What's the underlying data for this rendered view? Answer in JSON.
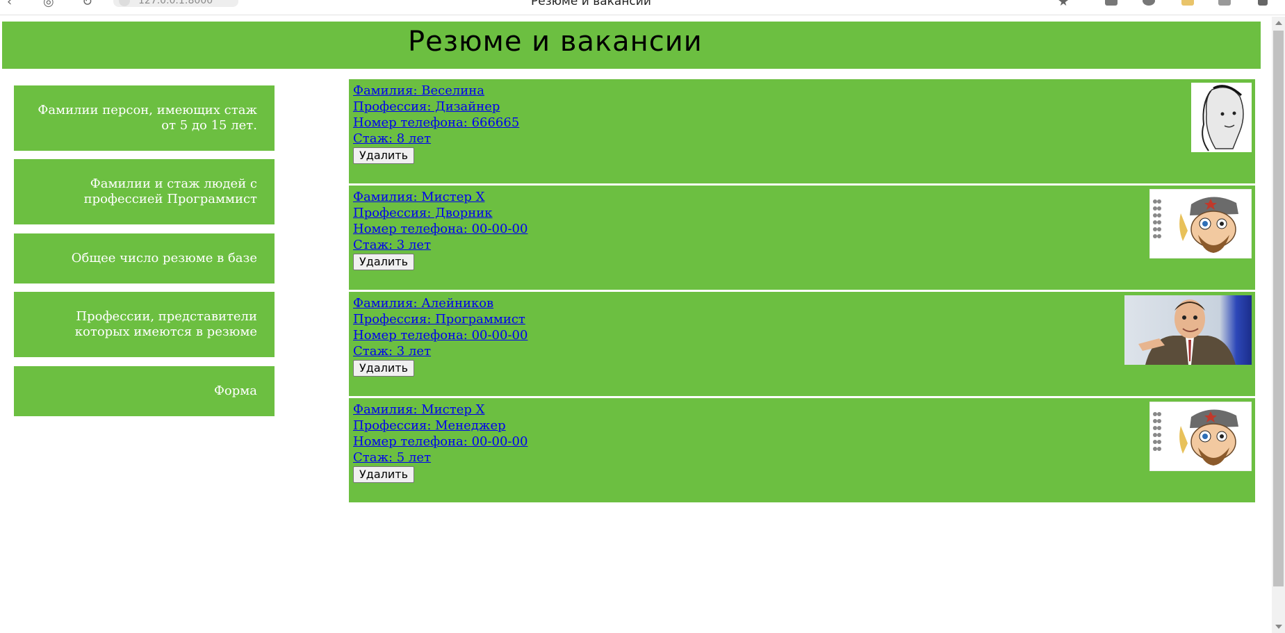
{
  "browser": {
    "url": "127.0.0.1:8000",
    "tab_title": "Резюме и вакансии"
  },
  "header": {
    "title": "Резюме и вакансии"
  },
  "sidebar": {
    "items": [
      {
        "label": "Фамилии персон, имеющих стаж от 5 до 15 лет."
      },
      {
        "label": "Фамилии и стаж людей с профессией Программист"
      },
      {
        "label": "Общее число резюме в базе"
      },
      {
        "label": "Профессии, представители которых имеются в резюме"
      },
      {
        "label": "Форма"
      }
    ]
  },
  "resumes": [
    {
      "surname": "Фамилия: Веселина",
      "profession": "Профессия: Дизайнер",
      "phone": "Номер телефона: 666665",
      "experience": "Стаж: 8 лет",
      "delete_label": "Удалить",
      "photo": "sketch-portrait"
    },
    {
      "surname": "Фамилия: Мистер Х",
      "profession": "Профессия: Дворник",
      "phone": "Номер телефона: 00-00-00",
      "experience": "Стаж: 3 лет",
      "delete_label": "Удалить",
      "photo": "cartoon-face-screenshot"
    },
    {
      "surname": "Фамилия: Алейников",
      "profession": "Профессия: Программист",
      "phone": "Номер телефона: 00-00-00",
      "experience": "Стаж: 3 лет",
      "delete_label": "Удалить",
      "photo": "man-pointing-photo"
    },
    {
      "surname": "Фамилия: Мистер Х",
      "profession": "Профессия: Менеджер",
      "phone": "Номер телефона: 00-00-00",
      "experience": "Стаж: 5 лет",
      "delete_label": "Удалить",
      "photo": "cartoon-face-screenshot"
    }
  ],
  "colors": {
    "accent_green": "#6cbf41",
    "link_blue": "#0000ee"
  }
}
